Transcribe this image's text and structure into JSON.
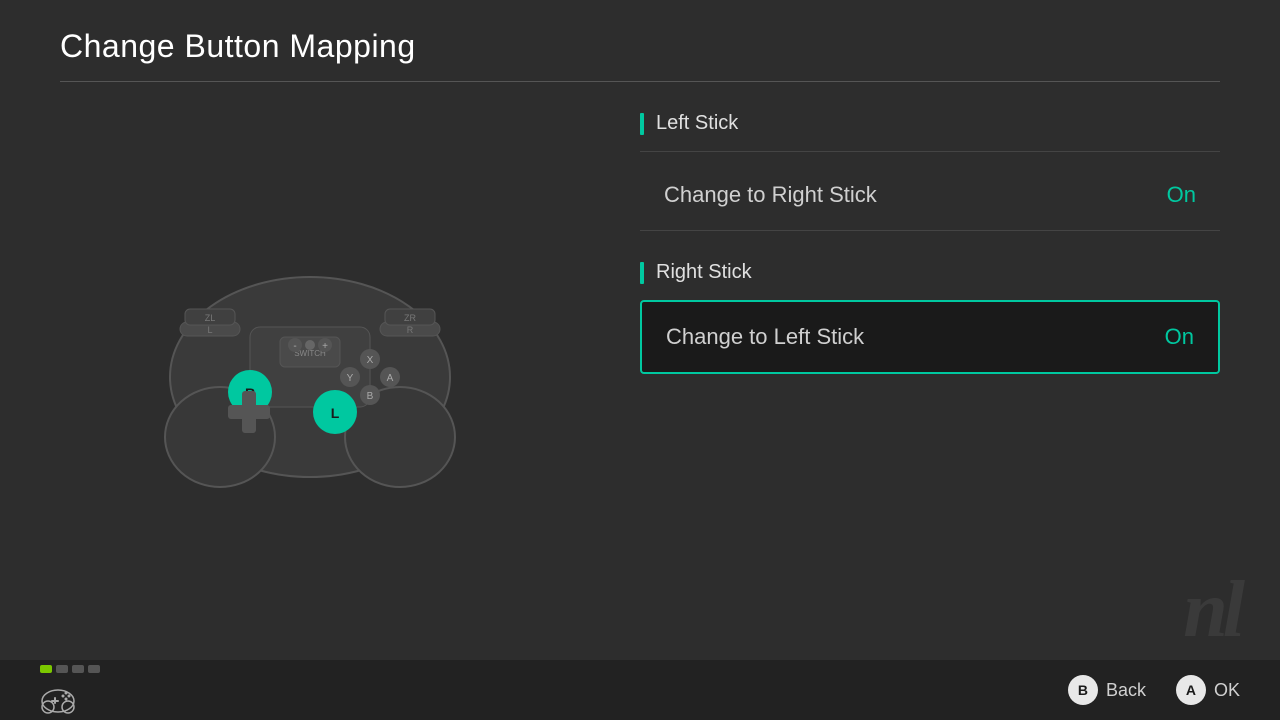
{
  "header": {
    "title": "Change Button Mapping"
  },
  "left_section": {
    "section_title": "Left Stick",
    "option": {
      "label": "Change to Right Stick",
      "value": "On",
      "selected": false
    }
  },
  "right_section": {
    "section_title": "Right Stick",
    "option": {
      "label": "Change to Left Stick",
      "value": "On",
      "selected": true
    }
  },
  "footer": {
    "back_label": "Back",
    "ok_label": "OK",
    "btn_b": "B",
    "btn_a": "A",
    "dots": [
      {
        "active": true
      },
      {
        "active": false
      },
      {
        "active": false
      },
      {
        "active": false
      }
    ]
  },
  "watermark": "nl"
}
